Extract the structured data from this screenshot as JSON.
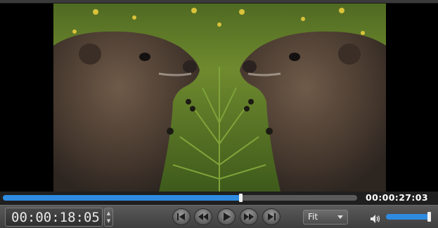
{
  "player": {
    "duration": "00:00:27:03",
    "current_timecode": "00:00:18:05",
    "progress_fraction": 0.67,
    "volume_fraction": 0.97,
    "scale_mode": "Fit",
    "accent_color": "#2e8be0"
  },
  "video": {
    "description_icon": "video-frame"
  },
  "controls": {
    "icons": {
      "stepper": "stepper-arrows-icon",
      "skip_start": "skip-to-start-icon",
      "rewind": "rewind-icon",
      "play": "play-icon",
      "fast_forward": "fast-forward-icon",
      "skip_end": "skip-to-end-icon",
      "volume": "speaker-icon",
      "dropdown": "chevron-down-icon"
    }
  }
}
